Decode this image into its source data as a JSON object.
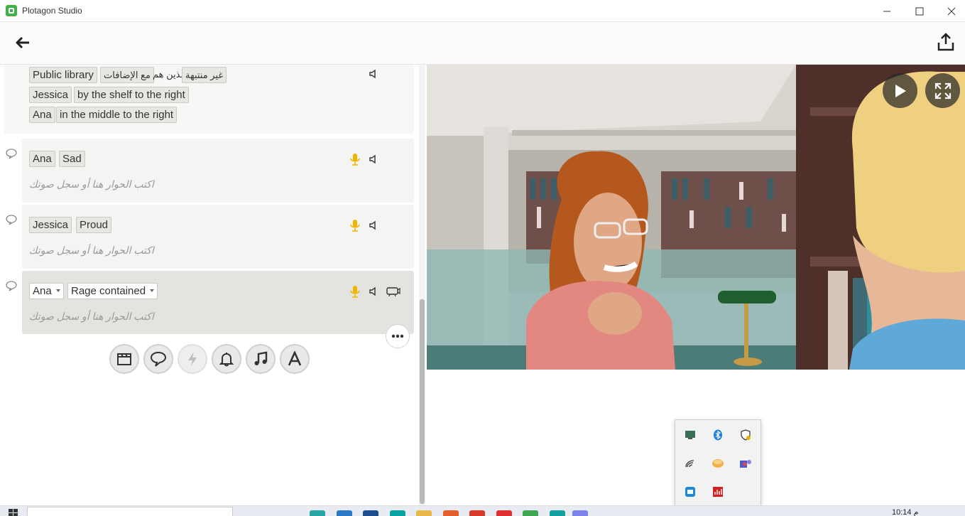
{
  "window": {
    "title": "Plotagon Studio"
  },
  "scene": {
    "location": "Public library",
    "modifier_1": "غير منتبهة",
    "modifier_text": "الذين هم",
    "modifier_2": "مع الإضافات",
    "characters": [
      {
        "name": "Jessica",
        "position": "by the shelf to the right"
      },
      {
        "name": "Ana",
        "position": "in the middle to the right"
      }
    ]
  },
  "dialogue": [
    {
      "character": "Ana",
      "emotion": "Sad",
      "placeholder": "اكتب الحوار هنا أو سجل صوتك"
    },
    {
      "character": "Jessica",
      "emotion": "Proud",
      "placeholder": "اكتب الحوار هنا أو سجل صوتك"
    },
    {
      "character": "Ana",
      "emotion": "Rage contained",
      "placeholder": "اكتب الحوار هنا أو سجل صوتك"
    }
  ],
  "toolbar": {
    "items": [
      "scene-clapper-icon",
      "dialogue-bubble-icon",
      "action-bolt-icon",
      "sound-bell-icon",
      "music-note-icon",
      "text-letter-icon"
    ]
  },
  "tray": {
    "icons": [
      "display-adapter-icon",
      "bluetooth-icon",
      "security-shield-icon",
      "wireless-icon",
      "disk-icon",
      "teams-icon",
      "camera-icon",
      "app-red-icon"
    ]
  },
  "taskbar": {
    "time": "10:14 م"
  },
  "colors": {
    "accent_mic": "#f0b400",
    "app_logo": "#3fb04a"
  }
}
